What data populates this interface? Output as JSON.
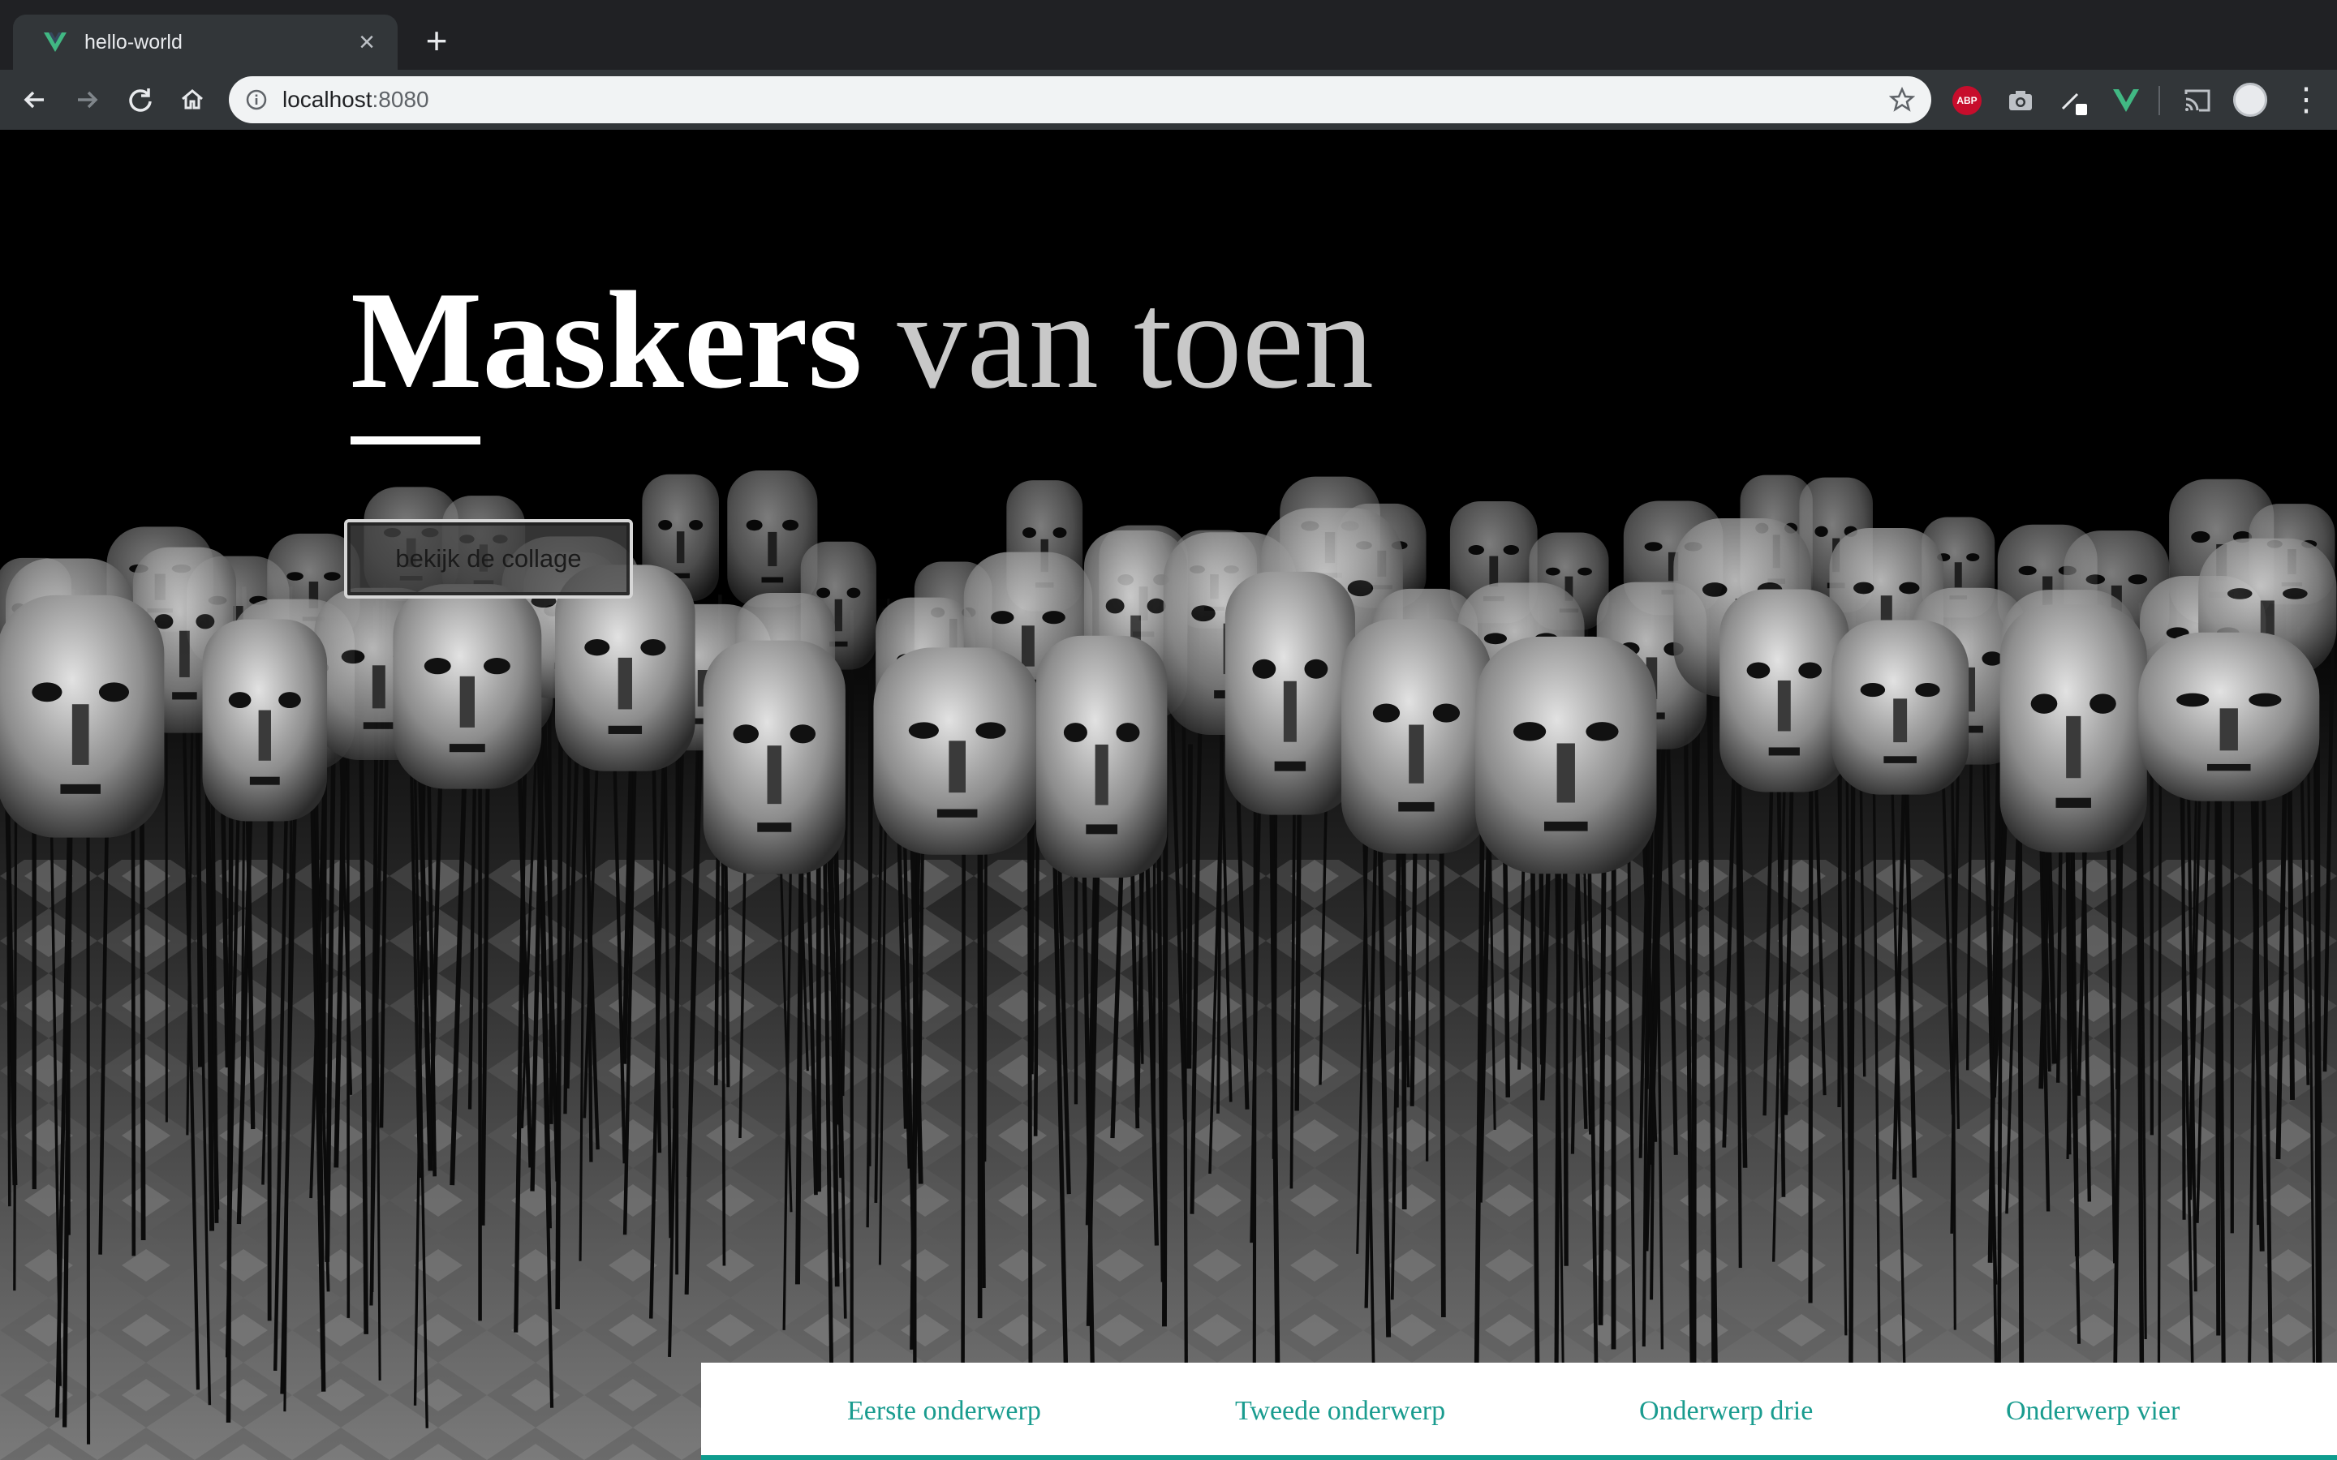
{
  "browser": {
    "tab": {
      "title": "hello-world",
      "favicon": "vue-logo-icon",
      "close_glyph": "×"
    },
    "new_tab_glyph": "+",
    "address": {
      "host": "localhost",
      "port": ":8080"
    },
    "extensions": [
      "adblock-plus-icon",
      "camera-icon",
      "eyedropper-icon",
      "vue-devtools-icon",
      "cast-icon",
      "profile-avatar"
    ],
    "abp_label": "ABP",
    "menu_glyph": "⋮"
  },
  "hero": {
    "title_strong": "Maskers",
    "title_light": "van toen",
    "button_label": "bekijk de collage"
  },
  "subnav": {
    "items": [
      "Eerste onderwerp",
      "Tweede onderwerp",
      "Onderwerp drie",
      "Onderwerp vier"
    ],
    "accent": "#0f9c8e"
  },
  "colors": {
    "vue_green": "#41b883",
    "chrome_dark": "#202124",
    "toolbar": "#323639"
  }
}
